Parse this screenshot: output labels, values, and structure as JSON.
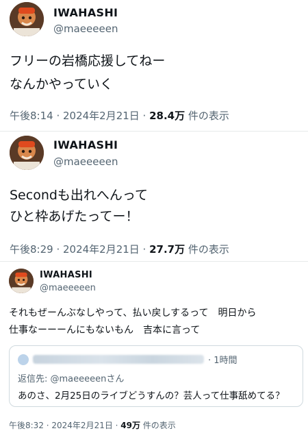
{
  "tweets": [
    {
      "name": "IWAHASHI",
      "handle": "@maeeeeen",
      "lines": [
        "フリーの岩橋応援してねー",
        "なんかやっていく"
      ],
      "time": "午後8:14 · 2024年2月21日 · ",
      "views": "28.4万",
      "views_suffix": " 件の表示"
    },
    {
      "name": "IWAHASHI",
      "handle": "@maeeeeen",
      "lines": [
        "Secondも出れへんって",
        "ひと枠あげたってー！"
      ],
      "time": "午後8:29 · 2024年2月21日 · ",
      "views": "27.7万",
      "views_suffix": " 件の表示"
    },
    {
      "name": "IWAHASHI",
      "handle": "@maeeeeen",
      "lines": [
        "それもぜーんぶなしやって、払い戻しするって　明日から",
        "仕事なーーーんにもないもん　吉本に言って"
      ],
      "quote": {
        "time": "· 1時間",
        "reply_to": "返信先: @maeeeeenさん",
        "text": "あのさ、2月25日のライブどうすんの？芸人って仕事舐めてる？"
      },
      "time": "午後8:32 · 2024年2月21日 · ",
      "views": "49万",
      "views_suffix": " 件の表示"
    }
  ]
}
